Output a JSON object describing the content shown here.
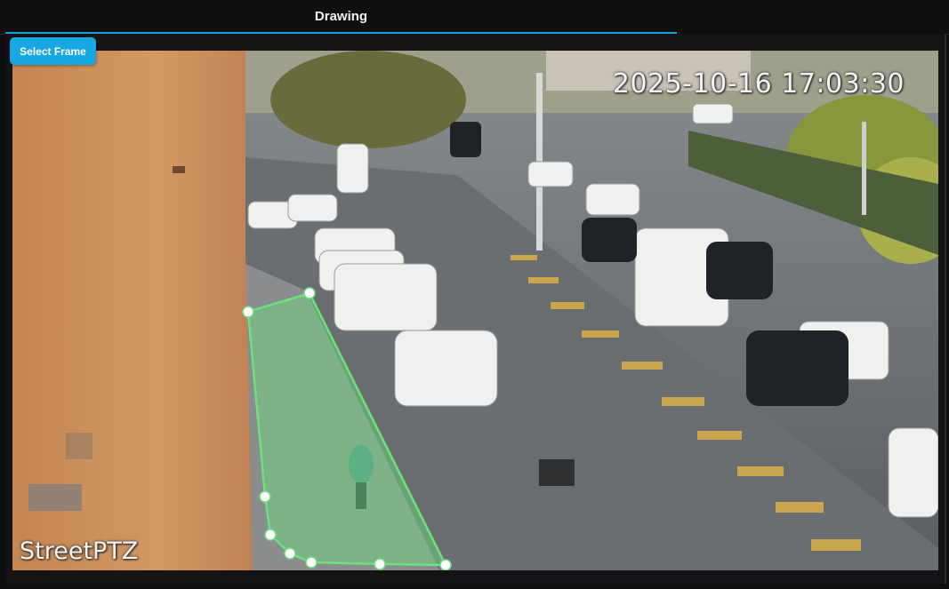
{
  "tabs": [
    {
      "label": "Drawing"
    }
  ],
  "toolbar": {
    "select_frame_label": "Select Frame"
  },
  "camera_frame": {
    "timestamp": "2025-10-16 17:03:30",
    "watermark": "StreetPTZ"
  },
  "zone": {
    "fill_color": "#6ee07e",
    "stroke_color": "#6ee07e",
    "vertex_count": 9
  },
  "colors": {
    "accent": "#17a8e2",
    "background": "#0f0f10"
  }
}
